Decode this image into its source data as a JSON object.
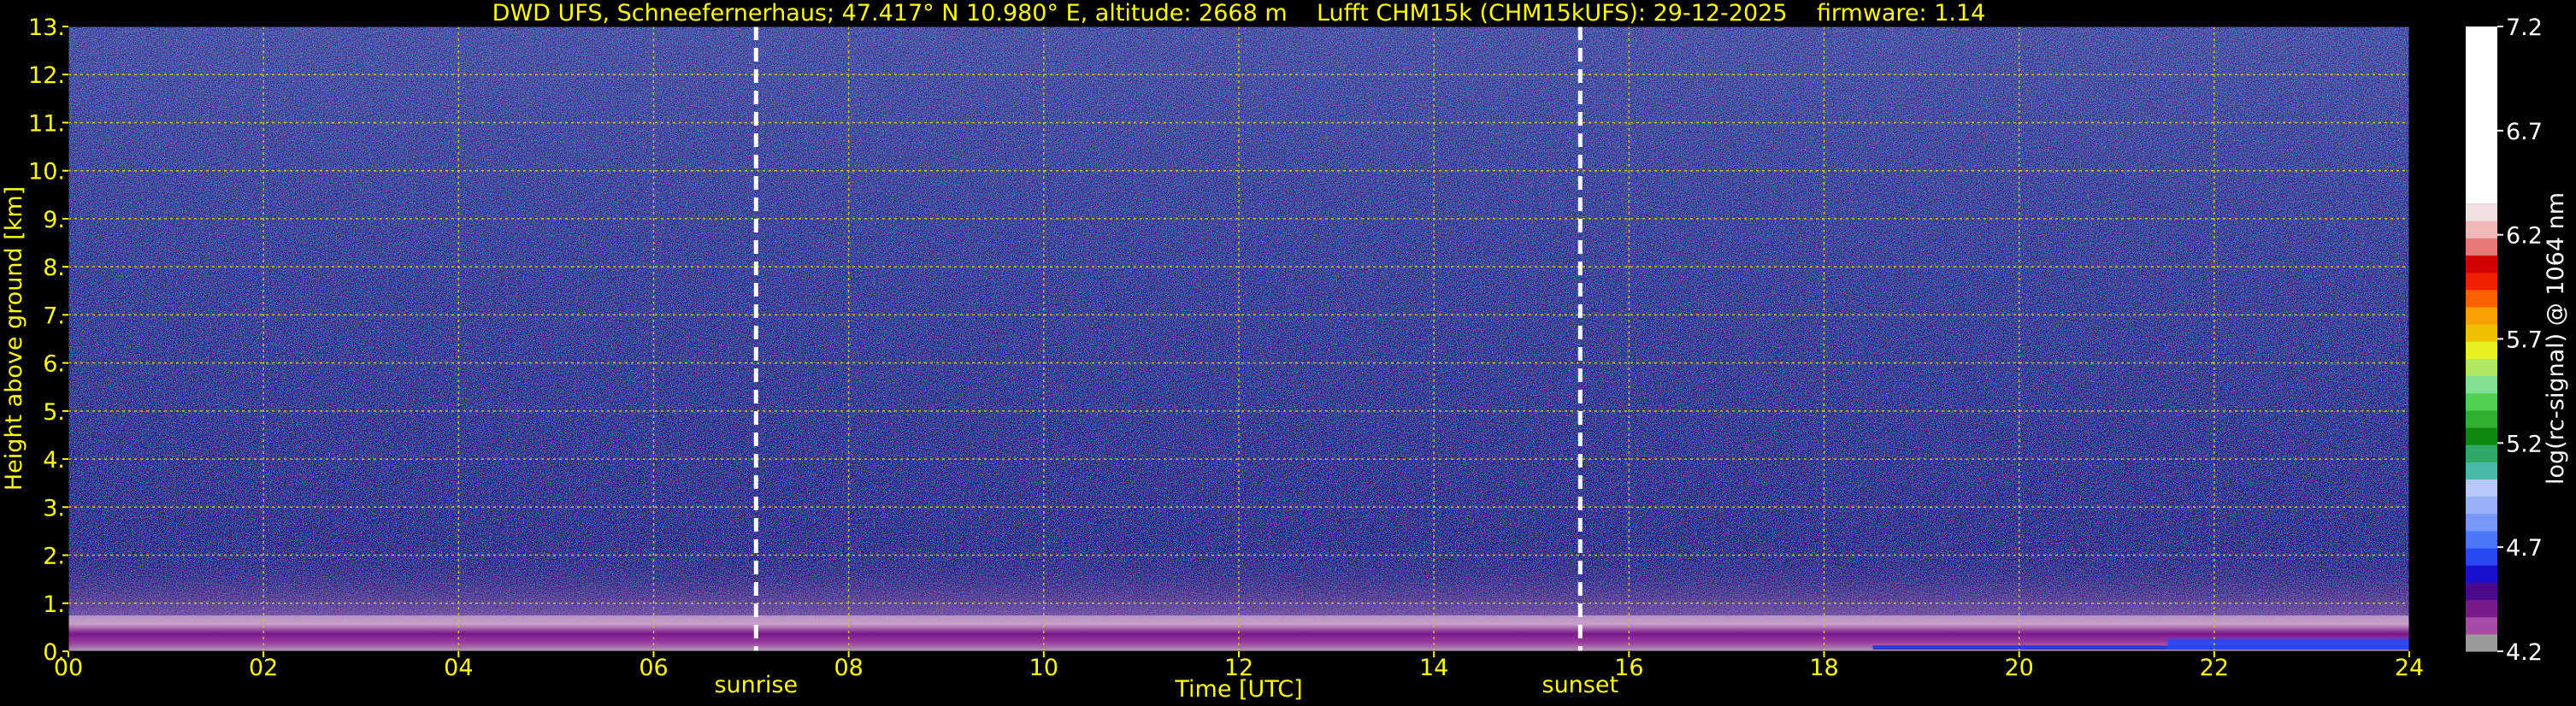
{
  "chart_data": {
    "type": "heatmap",
    "title": "DWD UFS, Schneefernerhaus; 47.417° N 10.980° E, altitude: 2668 m    Lufft CHM15k (CHM15kUFS): 29-12-2025    firmware: 1.14",
    "xlabel": "Time [UTC]",
    "ylabel": "Height above ground [km]",
    "xlim": [
      0,
      24
    ],
    "ylim": [
      0,
      13
    ],
    "x_ticks": [
      0,
      2,
      4,
      6,
      8,
      10,
      12,
      14,
      16,
      18,
      20,
      22,
      24
    ],
    "x_tick_labels": [
      "00",
      "02",
      "04",
      "06",
      "08",
      "10",
      "12",
      "14",
      "16",
      "18",
      "20",
      "22",
      "24"
    ],
    "y_ticks": [
      0,
      1,
      2,
      3,
      4,
      5,
      6,
      7,
      8,
      9,
      10,
      11,
      12,
      13
    ],
    "y_tick_labels": [
      "0.",
      "1.",
      "2.",
      "3.",
      "4.",
      "5.",
      "6.",
      "7.",
      "8.",
      "9.",
      "10.",
      "11.",
      "12.",
      "13."
    ],
    "grid": true,
    "annotations": [
      {
        "label": "sunrise",
        "x": 7.05
      },
      {
        "label": "sunset",
        "x": 15.5
      }
    ],
    "colorbar": {
      "label": "log(rc-signal) @ 1064 nm",
      "range": [
        4.2,
        7.2
      ],
      "ticks": [
        4.2,
        4.7,
        5.2,
        5.7,
        6.2,
        6.7,
        7.2
      ],
      "tick_labels": [
        "4.2",
        "4.7",
        "5.2",
        "5.7",
        "6.2",
        "6.7",
        "7.2"
      ],
      "colors": [
        "#9a9a9a",
        "#a84aa8",
        "#7a1a8a",
        "#4a0a8a",
        "#1a10d0",
        "#2848f0",
        "#4a78f8",
        "#7898f8",
        "#98b0f8",
        "#b8c8f8",
        "#48b8a8",
        "#30a868",
        "#108810",
        "#30b030",
        "#50d050",
        "#80e090",
        "#b0e860",
        "#e8f020",
        "#f0c000",
        "#f8a000",
        "#f86000",
        "#f02000",
        "#d00000",
        "#e87878",
        "#f0b8b8",
        "#f0e0e0",
        "#ffffff"
      ]
    },
    "layers": [
      {
        "description": "noise background",
        "height_km": [
          1.0,
          13.0
        ],
        "value_range": [
          4.2,
          5.0
        ]
      },
      {
        "description": "near-ground layer",
        "height_km": [
          0.0,
          1.0
        ],
        "value_range": [
          4.2,
          4.5
        ]
      },
      {
        "description": "aerosol layer",
        "x": [
          18.5,
          24
        ],
        "height_km": [
          0.0,
          0.3
        ],
        "value_range": [
          4.6,
          4.9
        ]
      }
    ]
  },
  "colors": {
    "background": "#000000",
    "text": "#ffff00",
    "grid": "#c8c800",
    "marker_line": "#ffffff",
    "colorbar_text": "#ffffff"
  }
}
